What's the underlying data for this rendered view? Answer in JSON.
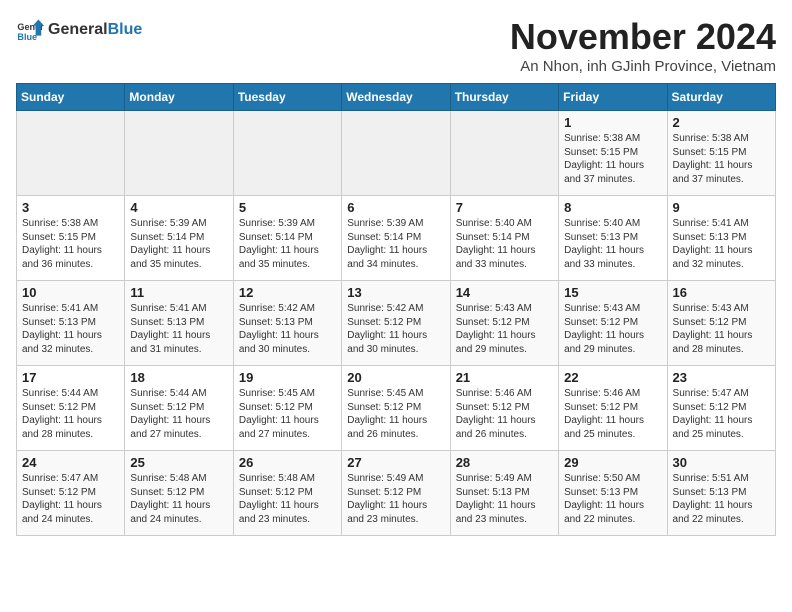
{
  "header": {
    "logo_general": "General",
    "logo_blue": "Blue",
    "month_title": "November 2024",
    "subtitle": "An Nhon, inh GJinh Province, Vietnam"
  },
  "days_of_week": [
    "Sunday",
    "Monday",
    "Tuesday",
    "Wednesday",
    "Thursday",
    "Friday",
    "Saturday"
  ],
  "weeks": [
    [
      {
        "day": "",
        "sunrise": "",
        "sunset": "",
        "daylight": ""
      },
      {
        "day": "",
        "sunrise": "",
        "sunset": "",
        "daylight": ""
      },
      {
        "day": "",
        "sunrise": "",
        "sunset": "",
        "daylight": ""
      },
      {
        "day": "",
        "sunrise": "",
        "sunset": "",
        "daylight": ""
      },
      {
        "day": "",
        "sunrise": "",
        "sunset": "",
        "daylight": ""
      },
      {
        "day": "1",
        "sunrise": "Sunrise: 5:38 AM",
        "sunset": "Sunset: 5:15 PM",
        "daylight": "Daylight: 11 hours and 37 minutes."
      },
      {
        "day": "2",
        "sunrise": "Sunrise: 5:38 AM",
        "sunset": "Sunset: 5:15 PM",
        "daylight": "Daylight: 11 hours and 37 minutes."
      }
    ],
    [
      {
        "day": "3",
        "sunrise": "Sunrise: 5:38 AM",
        "sunset": "Sunset: 5:15 PM",
        "daylight": "Daylight: 11 hours and 36 minutes."
      },
      {
        "day": "4",
        "sunrise": "Sunrise: 5:39 AM",
        "sunset": "Sunset: 5:14 PM",
        "daylight": "Daylight: 11 hours and 35 minutes."
      },
      {
        "day": "5",
        "sunrise": "Sunrise: 5:39 AM",
        "sunset": "Sunset: 5:14 PM",
        "daylight": "Daylight: 11 hours and 35 minutes."
      },
      {
        "day": "6",
        "sunrise": "Sunrise: 5:39 AM",
        "sunset": "Sunset: 5:14 PM",
        "daylight": "Daylight: 11 hours and 34 minutes."
      },
      {
        "day": "7",
        "sunrise": "Sunrise: 5:40 AM",
        "sunset": "Sunset: 5:14 PM",
        "daylight": "Daylight: 11 hours and 33 minutes."
      },
      {
        "day": "8",
        "sunrise": "Sunrise: 5:40 AM",
        "sunset": "Sunset: 5:13 PM",
        "daylight": "Daylight: 11 hours and 33 minutes."
      },
      {
        "day": "9",
        "sunrise": "Sunrise: 5:41 AM",
        "sunset": "Sunset: 5:13 PM",
        "daylight": "Daylight: 11 hours and 32 minutes."
      }
    ],
    [
      {
        "day": "10",
        "sunrise": "Sunrise: 5:41 AM",
        "sunset": "Sunset: 5:13 PM",
        "daylight": "Daylight: 11 hours and 32 minutes."
      },
      {
        "day": "11",
        "sunrise": "Sunrise: 5:41 AM",
        "sunset": "Sunset: 5:13 PM",
        "daylight": "Daylight: 11 hours and 31 minutes."
      },
      {
        "day": "12",
        "sunrise": "Sunrise: 5:42 AM",
        "sunset": "Sunset: 5:13 PM",
        "daylight": "Daylight: 11 hours and 30 minutes."
      },
      {
        "day": "13",
        "sunrise": "Sunrise: 5:42 AM",
        "sunset": "Sunset: 5:12 PM",
        "daylight": "Daylight: 11 hours and 30 minutes."
      },
      {
        "day": "14",
        "sunrise": "Sunrise: 5:43 AM",
        "sunset": "Sunset: 5:12 PM",
        "daylight": "Daylight: 11 hours and 29 minutes."
      },
      {
        "day": "15",
        "sunrise": "Sunrise: 5:43 AM",
        "sunset": "Sunset: 5:12 PM",
        "daylight": "Daylight: 11 hours and 29 minutes."
      },
      {
        "day": "16",
        "sunrise": "Sunrise: 5:43 AM",
        "sunset": "Sunset: 5:12 PM",
        "daylight": "Daylight: 11 hours and 28 minutes."
      }
    ],
    [
      {
        "day": "17",
        "sunrise": "Sunrise: 5:44 AM",
        "sunset": "Sunset: 5:12 PM",
        "daylight": "Daylight: 11 hours and 28 minutes."
      },
      {
        "day": "18",
        "sunrise": "Sunrise: 5:44 AM",
        "sunset": "Sunset: 5:12 PM",
        "daylight": "Daylight: 11 hours and 27 minutes."
      },
      {
        "day": "19",
        "sunrise": "Sunrise: 5:45 AM",
        "sunset": "Sunset: 5:12 PM",
        "daylight": "Daylight: 11 hours and 27 minutes."
      },
      {
        "day": "20",
        "sunrise": "Sunrise: 5:45 AM",
        "sunset": "Sunset: 5:12 PM",
        "daylight": "Daylight: 11 hours and 26 minutes."
      },
      {
        "day": "21",
        "sunrise": "Sunrise: 5:46 AM",
        "sunset": "Sunset: 5:12 PM",
        "daylight": "Daylight: 11 hours and 26 minutes."
      },
      {
        "day": "22",
        "sunrise": "Sunrise: 5:46 AM",
        "sunset": "Sunset: 5:12 PM",
        "daylight": "Daylight: 11 hours and 25 minutes."
      },
      {
        "day": "23",
        "sunrise": "Sunrise: 5:47 AM",
        "sunset": "Sunset: 5:12 PM",
        "daylight": "Daylight: 11 hours and 25 minutes."
      }
    ],
    [
      {
        "day": "24",
        "sunrise": "Sunrise: 5:47 AM",
        "sunset": "Sunset: 5:12 PM",
        "daylight": "Daylight: 11 hours and 24 minutes."
      },
      {
        "day": "25",
        "sunrise": "Sunrise: 5:48 AM",
        "sunset": "Sunset: 5:12 PM",
        "daylight": "Daylight: 11 hours and 24 minutes."
      },
      {
        "day": "26",
        "sunrise": "Sunrise: 5:48 AM",
        "sunset": "Sunset: 5:12 PM",
        "daylight": "Daylight: 11 hours and 23 minutes."
      },
      {
        "day": "27",
        "sunrise": "Sunrise: 5:49 AM",
        "sunset": "Sunset: 5:12 PM",
        "daylight": "Daylight: 11 hours and 23 minutes."
      },
      {
        "day": "28",
        "sunrise": "Sunrise: 5:49 AM",
        "sunset": "Sunset: 5:13 PM",
        "daylight": "Daylight: 11 hours and 23 minutes."
      },
      {
        "day": "29",
        "sunrise": "Sunrise: 5:50 AM",
        "sunset": "Sunset: 5:13 PM",
        "daylight": "Daylight: 11 hours and 22 minutes."
      },
      {
        "day": "30",
        "sunrise": "Sunrise: 5:51 AM",
        "sunset": "Sunset: 5:13 PM",
        "daylight": "Daylight: 11 hours and 22 minutes."
      }
    ]
  ]
}
